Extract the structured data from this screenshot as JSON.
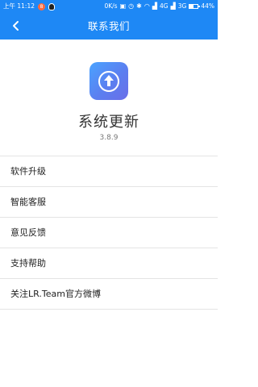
{
  "status_bar": {
    "time": "上午 11:12",
    "notification_count": "8",
    "network_speed": "0K/s",
    "signal_text": "4G",
    "sim2_text": "3G",
    "battery_percent": "44%",
    "battery_level": 0.44
  },
  "header": {
    "title": "联系我们",
    "back_icon": "chevron-left-icon"
  },
  "app_info": {
    "logo_icon": "upload-arrow-icon",
    "name": "系统更新",
    "version": "3.8.9"
  },
  "menu": {
    "items": [
      {
        "label": "软件升级"
      },
      {
        "label": "智能客服"
      },
      {
        "label": "意见反馈"
      },
      {
        "label": "支持帮助"
      },
      {
        "label": "关注LR.Team官方微博"
      }
    ]
  },
  "colors": {
    "primary": "#1e88f5",
    "logo_gradient_start": "#4aa3ff",
    "logo_gradient_end": "#6a6ee8",
    "divider": "#e4e4e4"
  }
}
